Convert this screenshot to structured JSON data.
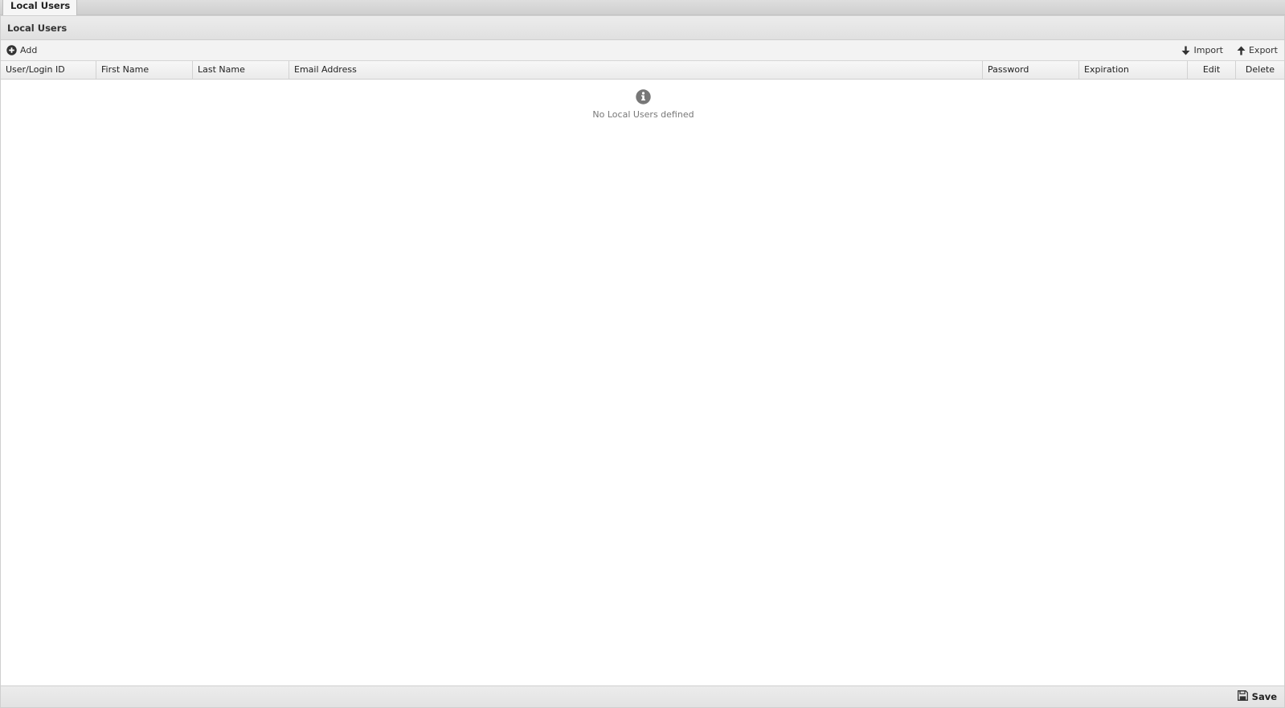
{
  "tab": {
    "label": "Local Users"
  },
  "panel": {
    "title": "Local Users"
  },
  "toolbar": {
    "add_label": "Add",
    "import_label": "Import",
    "export_label": "Export"
  },
  "grid": {
    "columns": [
      "User/Login ID",
      "First Name",
      "Last Name",
      "Email Address",
      "Password",
      "Expiration",
      "Edit",
      "Delete"
    ],
    "empty_message": "No Local Users defined"
  },
  "footer": {
    "save_label": "Save"
  },
  "colors": {
    "icon_gray": "#777777",
    "dark_icon": "#333333"
  },
  "icons": {
    "add": "plus-circle-icon",
    "import": "arrow-down-icon",
    "export": "arrow-up-icon",
    "empty": "info-circle-icon",
    "save": "floppy-disk-icon"
  }
}
